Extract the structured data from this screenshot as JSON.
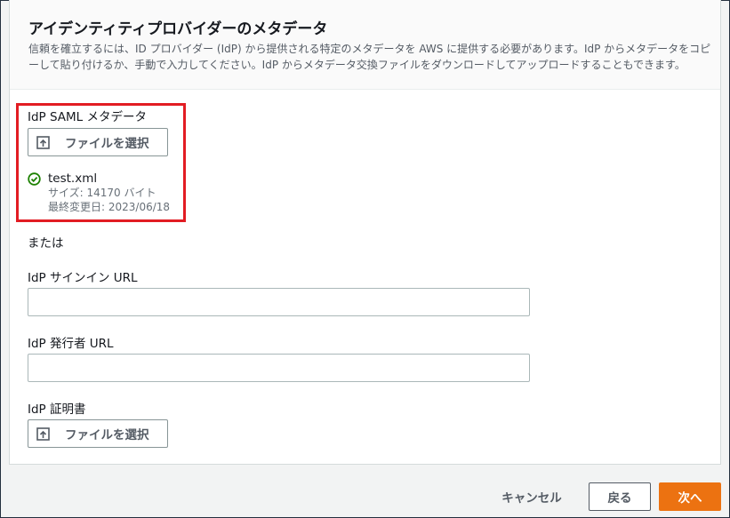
{
  "panel": {
    "title": "アイデンティティプロバイダーのメタデータ",
    "description": "信頼を確立するには、ID プロバイダー (IdP) から提供される特定のメタデータを AWS に提供する必要があります。IdP からメタデータをコピーして貼り付けるか、手動で入力してください。IdP からメタデータ交換ファイルをダウンロードしてアップロードすることもできます。"
  },
  "saml_metadata": {
    "label": "IdP SAML メタデータ",
    "choose_file_label": "ファイルを選択",
    "file_name": "test.xml",
    "file_size": "サイズ: 14170 バイト",
    "file_modified": "最終変更日: 2023/06/18"
  },
  "or_text": "または",
  "signin_url": {
    "label": "IdP サインイン URL",
    "value": ""
  },
  "issuer_url": {
    "label": "IdP 発行者 URL",
    "value": ""
  },
  "certificate": {
    "label": "IdP 証明書",
    "choose_file_label": "ファイルを選択"
  },
  "footer": {
    "cancel_label": "キャンセル",
    "back_label": "戻る",
    "next_label": "次へ"
  },
  "colors": {
    "accent": "#ec7211",
    "success": "#1d8102",
    "highlight": "#e21c23"
  },
  "icons": [
    "upload-icon",
    "check-circle-icon"
  ]
}
